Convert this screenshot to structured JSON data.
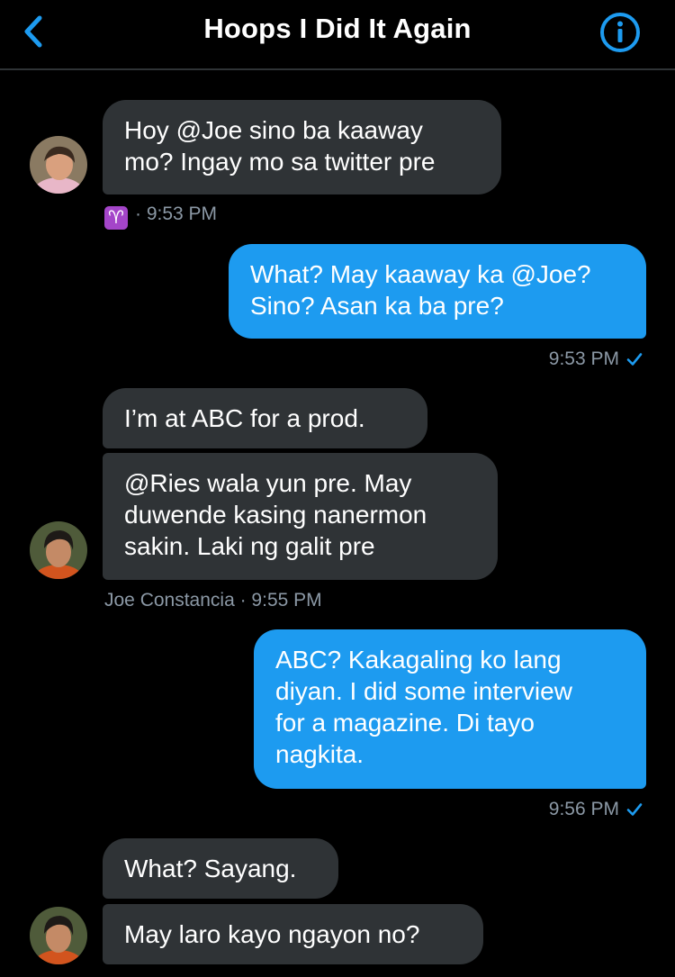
{
  "header": {
    "title": "Hoops I Did It Again"
  },
  "messages": [
    {
      "lines": [
        "Hoy @Joe sino ba kaaway",
        "mo? Ingay mo sa twitter pre"
      ]
    },
    {
      "lines": [
        "What? May kaaway ka @Joe?",
        "Sino? Asan ka ba pre?"
      ]
    },
    {
      "lines": [
        "I’m at ABC for a prod."
      ]
    },
    {
      "lines": [
        "@Ries wala yun pre. May",
        "duwende kasing nanermon",
        "sakin. Laki ng galit pre"
      ]
    },
    {
      "lines": [
        "ABC? Kakagaling ko lang",
        "diyan. I did some interview",
        "for a magazine. Di tayo",
        "nagkita."
      ]
    },
    {
      "lines": [
        "What? Sayang."
      ]
    },
    {
      "lines": [
        "May laro kayo ngayon no?"
      ]
    }
  ],
  "meta": {
    "m1": {
      "zodiac": "♈",
      "time": "· 9:53 PM"
    },
    "m2": {
      "time": "9:53 PM"
    },
    "m4": {
      "sender": "Joe Constancia",
      "time": "· 9:55 PM"
    },
    "m5": {
      "time": "9:56 PM"
    }
  },
  "colors": {
    "background": "#000000",
    "incoming_bubble": "#2f3336",
    "outgoing_bubble": "#1d9bf0",
    "accent": "#1d9bf0",
    "meta_text": "#8b98a5"
  },
  "icons": {
    "back": "chevron-left-icon",
    "info": "info-circle-icon",
    "sent": "checkmark-icon"
  }
}
